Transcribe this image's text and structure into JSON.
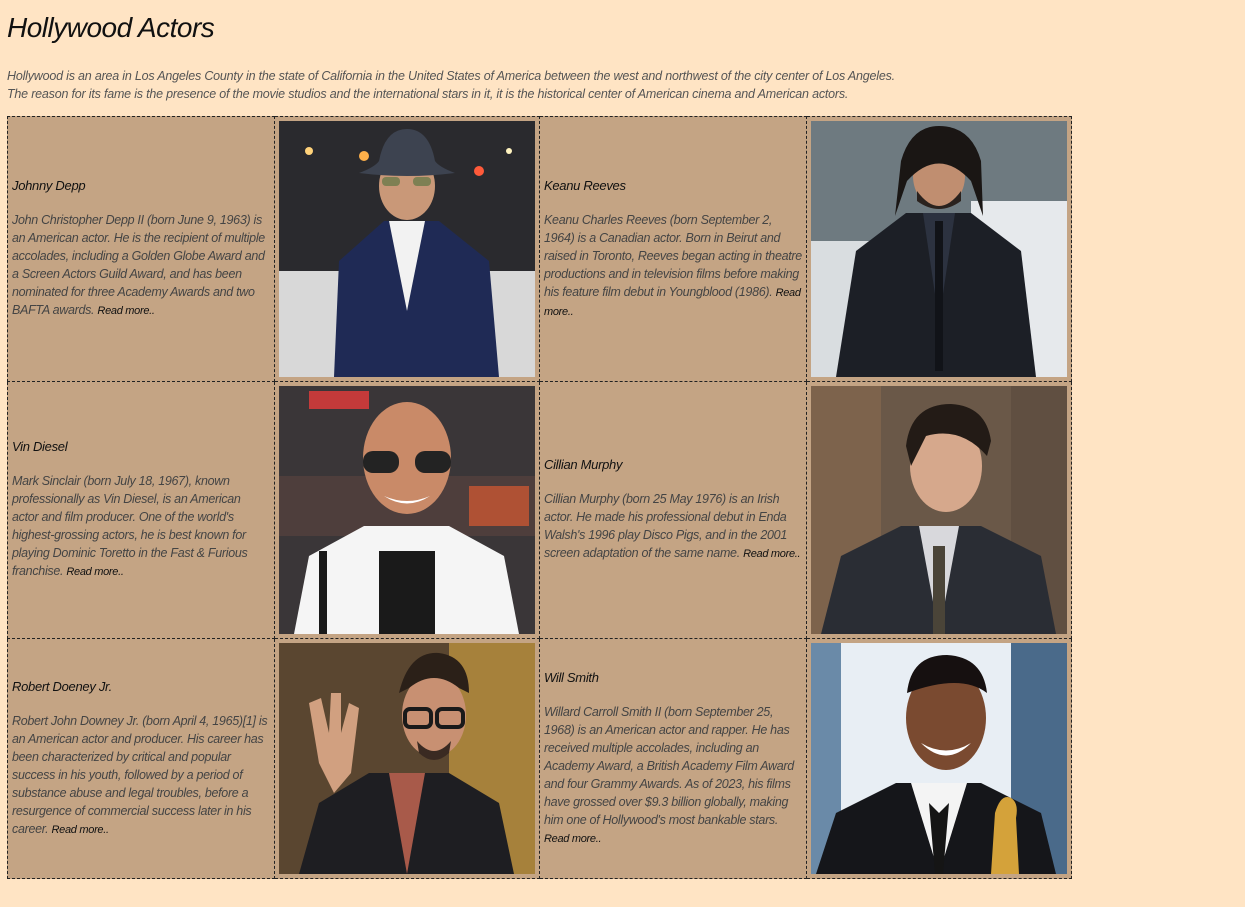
{
  "page": {
    "title": "Hollywood Actors",
    "intro_line1": "Hollywood is an area in Los Angeles County in the state of California in the United States of America between the west and northwest of the city center of Los Angeles.",
    "intro_line2": "The reason for its fame is the presence of the movie studios and the international stars in it, it is the historical center of American cinema and American actors."
  },
  "read_more_label": "Read more..",
  "colors": {
    "page_background": "#ffe4c4",
    "table_background": "#c4a484"
  },
  "actors": [
    {
      "name": "Johnny Depp",
      "bio": "John Christopher Depp II (born June 9, 1963) is an American actor. He is the recipient of multiple accolades, including a Golden Globe Award and a Screen Actors Guild Award, and has been nominated for three Academy Awards and two BAFTA awards."
    },
    {
      "name": "Keanu Reeves",
      "bio": "Keanu Charles Reeves (born September 2, 1964) is a Canadian actor. Born in Beirut and raised in Toronto, Reeves began acting in theatre productions and in television films before making his feature film debut in Youngblood (1986)."
    },
    {
      "name": "Vin Diesel",
      "bio": "Mark Sinclair (born July 18, 1967), known professionally as Vin Diesel, is an American actor and film producer. One of the world's highest-grossing actors, he is best known for playing Dominic Toretto in the Fast & Furious franchise."
    },
    {
      "name": "Cillian Murphy",
      "bio": "Cillian Murphy (born 25 May 1976) is an Irish actor. He made his professional debut in Enda Walsh's 1996 play Disco Pigs, and in the 2001 screen adaptation of the same name."
    },
    {
      "name": "Robert Doeney Jr.",
      "bio": "Robert John Downey Jr. (born April 4, 1965)[1] is an American actor and producer. His career has been characterized by critical and popular success in his youth, followed by a period of substance abuse and legal troubles, before a resurgence of commercial success later in his career."
    },
    {
      "name": "Will Smith",
      "bio": "Willard Carroll Smith II (born September 25, 1968) is an American actor and rapper. He has received multiple accolades, including an Academy Award, a British Academy Film Award and four Grammy Awards. As of 2023, his films have grossed over $9.3 billion globally, making him one of Hollywood's most bankable stars."
    }
  ]
}
